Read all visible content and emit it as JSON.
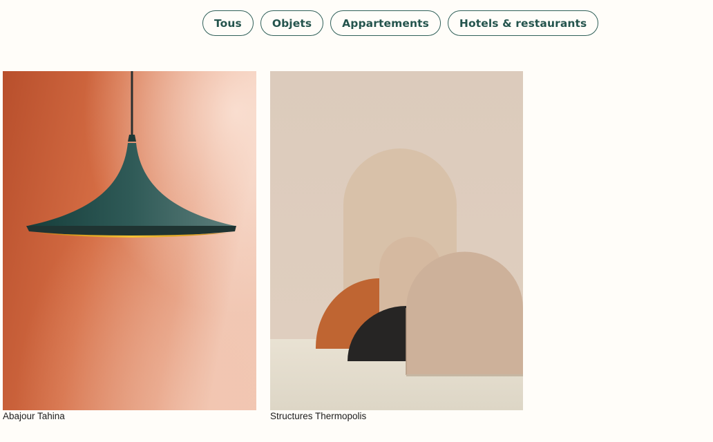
{
  "filters": [
    {
      "label": "Tous"
    },
    {
      "label": "Objets"
    },
    {
      "label": "Appartements"
    },
    {
      "label": "Hotels & restaurants"
    }
  ],
  "cards": [
    {
      "caption": "Abajour Tahina",
      "image": "orange-wall-pendant-lamp"
    },
    {
      "caption": "Structures Thermopolis",
      "image": "arched-panel-structures"
    }
  ],
  "colors": {
    "background": "#fffdf9",
    "pill_border": "#2f5f58",
    "pill_text": "#24544d"
  }
}
